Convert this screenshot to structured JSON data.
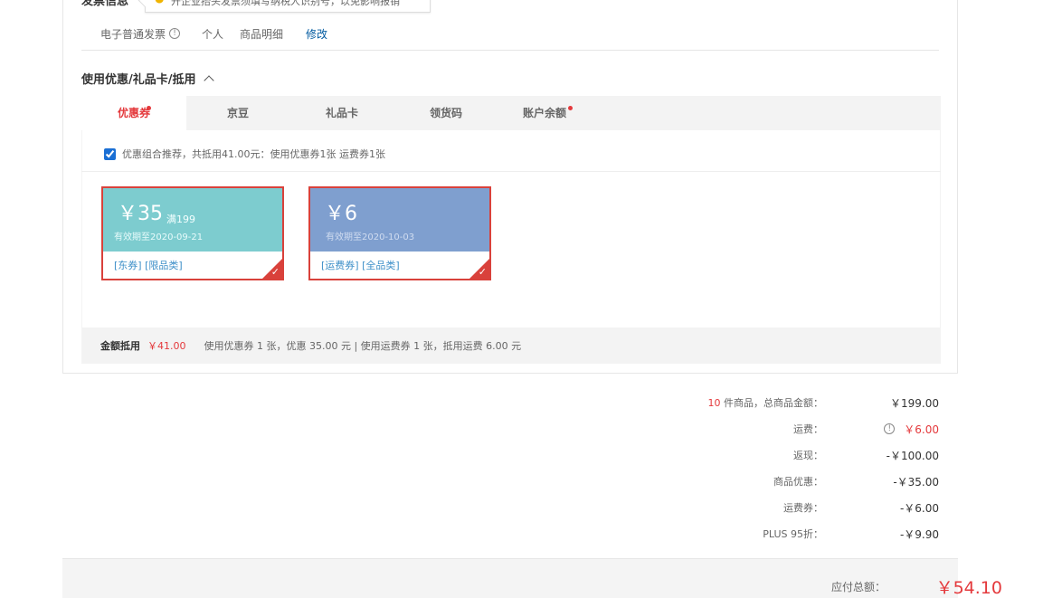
{
  "invoice": {
    "title": "发票信息",
    "tip": "开企业抬头发票须填写纳税人识别号，以免影响报销",
    "type": "电子普通发票",
    "title_type": "个人",
    "content": "商品明细",
    "edit": "修改"
  },
  "discount_section": {
    "title": "使用优惠/礼品卡/抵用",
    "tabs": [
      {
        "label": "优惠券",
        "active": true,
        "has_dot": true
      },
      {
        "label": "京豆",
        "active": false,
        "has_dot": false
      },
      {
        "label": "礼品卡",
        "active": false,
        "has_dot": false
      },
      {
        "label": "领货码",
        "active": false,
        "has_dot": false
      },
      {
        "label": "账户余额",
        "active": false,
        "has_dot": true
      }
    ],
    "combo_text": "优惠组合推荐，共抵用41.00元：使用优惠券1张 运费券1张",
    "combo_checked": true,
    "coupons": [
      {
        "amount": "￥35",
        "condition": "满199",
        "expiry": "有效期至2020-09-21",
        "tags": "[东券]  [限品类]",
        "color": "#7dcccf",
        "selected": true
      },
      {
        "amount": "￥6",
        "condition": "",
        "expiry": "有效期至2020-10-03",
        "tags": "[运费券]  [全品类]",
        "color": "#7f9fcf",
        "selected": true
      }
    ],
    "summary": {
      "label": "金额抵用",
      "amount": "￥41.00",
      "detail": "使用优惠券 1 张，优惠 35.00 元  | 使用运费券 1 张，抵用运费 6.00 元"
    }
  },
  "order_summary": {
    "items_count": "10",
    "items_label": " 件商品，总商品金额：",
    "items_total": "￥199.00",
    "shipping_label": "运费：",
    "shipping_value": "￥6.00",
    "cashback_label": "返现：",
    "cashback_value": "-￥100.00",
    "product_discount_label": "商品优惠：",
    "product_discount_value": "-￥35.00",
    "shipping_coupon_label": "运费券：",
    "shipping_coupon_value": "-￥6.00",
    "plus_label": "PLUS 95折：",
    "plus_value": "-￥9.90",
    "total_label": "应付总额：",
    "total_value": "￥54.10"
  },
  "colors": {
    "accent_red": "#e4393c",
    "link_blue": "#005aa0",
    "coupon_teal": "#7dcccf",
    "coupon_blue": "#7f9fcf"
  }
}
